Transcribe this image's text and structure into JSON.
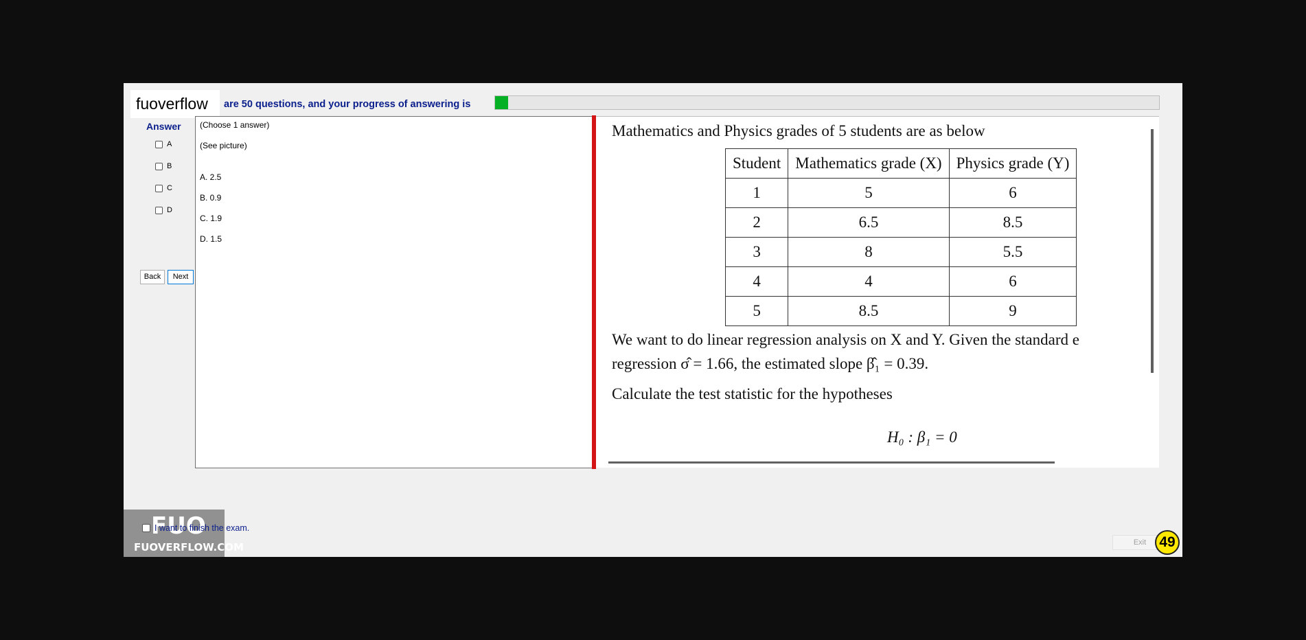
{
  "header": {
    "logo_text": "fuoverflow",
    "progress_text": "are 50 questions, and your progress of answering is",
    "progress_fraction": 0.02
  },
  "answer_panel": {
    "title": "Answer",
    "options": [
      "A",
      "B",
      "C",
      "D"
    ],
    "back_label": "Back",
    "next_label": "Next"
  },
  "question": {
    "instruction": "(Choose 1 answer)",
    "reference": "(See picture)",
    "choices": [
      "A.  2.5",
      "B.  0.9",
      "C.  1.9",
      "D.  1.5"
    ]
  },
  "picture": {
    "intro": "Mathematics and Physics grades of 5 students are as below",
    "table": {
      "headers": [
        "Student",
        "Mathematics grade (X)",
        "Physics grade (Y)"
      ],
      "rows": [
        [
          "1",
          "5",
          "6"
        ],
        [
          "2",
          "6.5",
          "8.5"
        ],
        [
          "3",
          "8",
          "5.5"
        ],
        [
          "4",
          "4",
          "6"
        ],
        [
          "5",
          "8.5",
          "9"
        ]
      ]
    },
    "line1": "We want to do linear regression analysis on X and Y. Given the standard e",
    "line2": "regression σ̂ = 1.66, the estimated slope β̂₁ = 0.39.",
    "line3": "Calculate the test statistic for the hypotheses",
    "hypothesis": "H₀ : β₁ = 0"
  },
  "footer": {
    "finish_label": "I want to finish the exam.",
    "exit_label": "Exit",
    "question_number": "49",
    "watermark_logo": "FUO",
    "watermark_site": "FUOVERFLOW.COM"
  }
}
